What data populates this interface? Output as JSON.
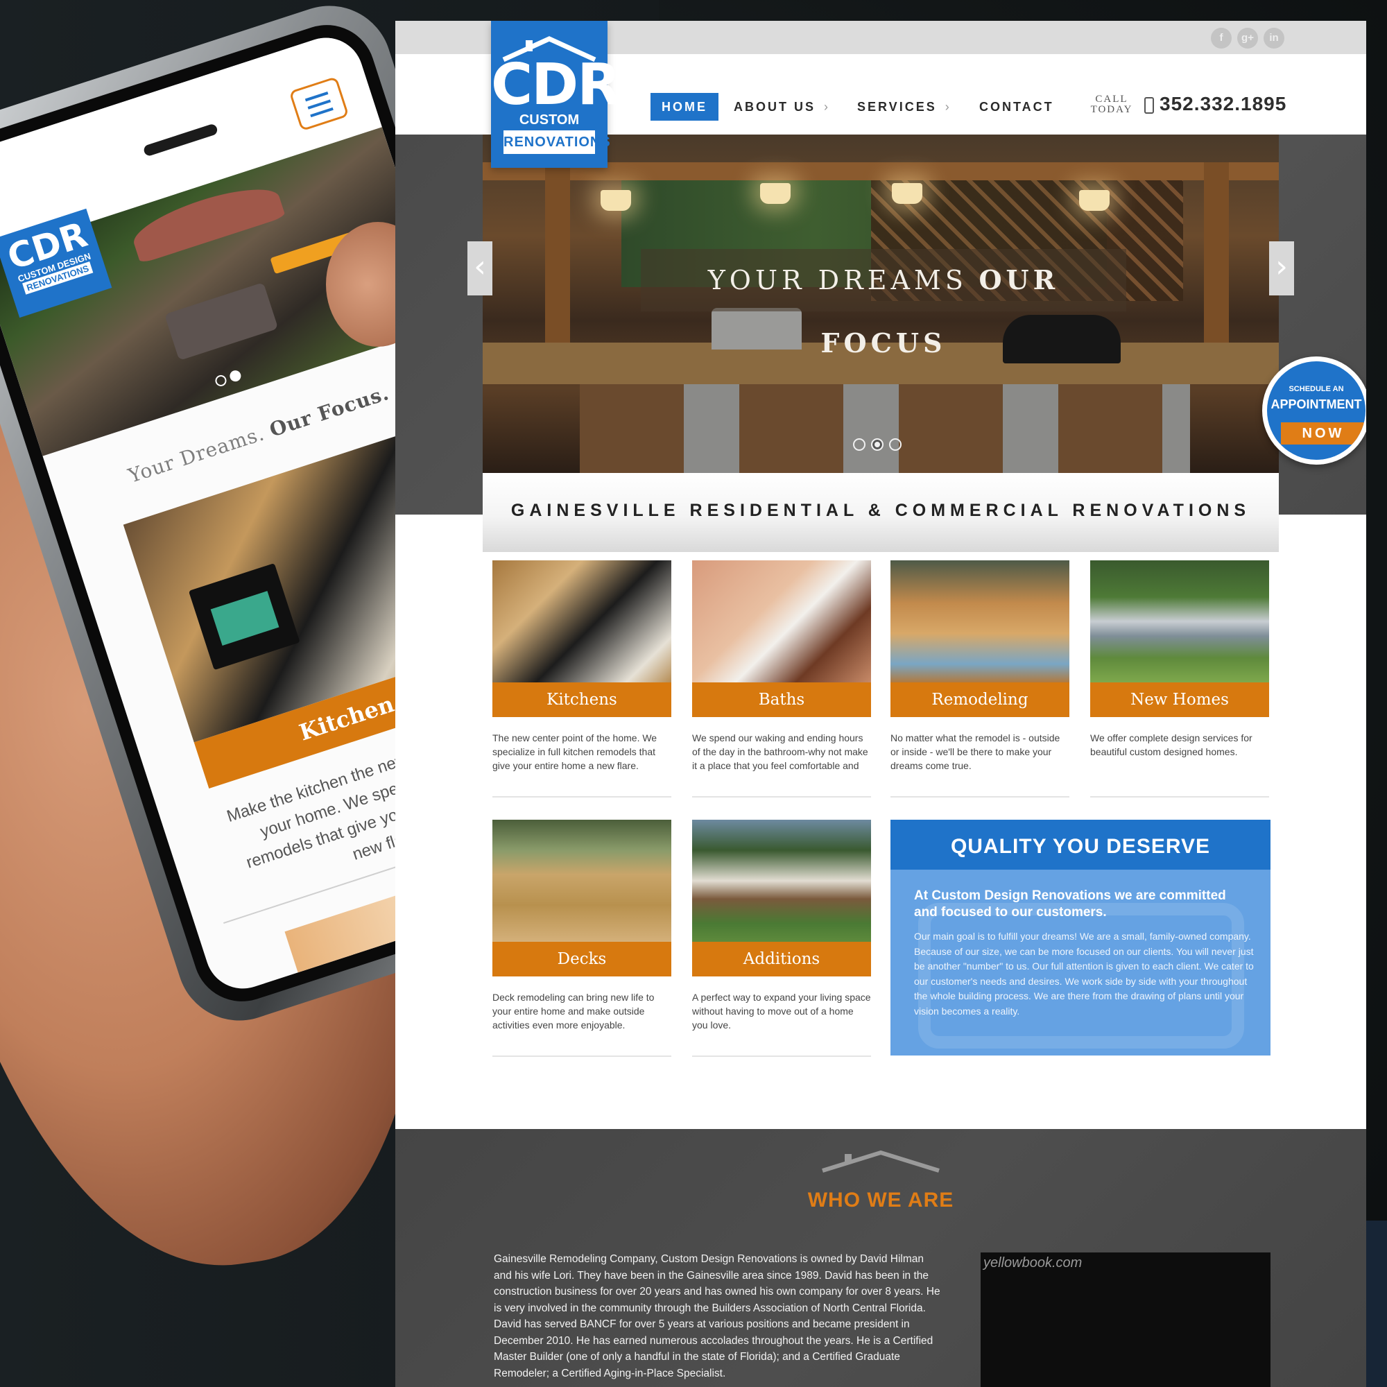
{
  "phone": {
    "logo_big": "CDR",
    "logo_small": "CUSTOM DESIGN",
    "logo_boxed": "RENOVATIONS",
    "tagline_light": "Your Dreams.",
    "tagline_bold": "Our Focus.",
    "card_label": "Kitchen",
    "card_text": "Make the kitchen the new focal point of your home. We specialize in full remodels that give your entire home a new flare."
  },
  "site": {
    "logo": {
      "big": "CDR",
      "line1": "CUSTOM DESIGN",
      "line2": "RENOVATIONS"
    },
    "social": [
      "f",
      "g+",
      "in"
    ],
    "nav": {
      "home": "HOME",
      "about": "ABOUT US",
      "services": "SERVICES",
      "contact": "CONTACT",
      "chevron": "›"
    },
    "call": {
      "line1": "CALL",
      "line2": "TODAY",
      "phone": "352.332.1895"
    },
    "hero": {
      "caption_light": "YOUR DREAMS",
      "caption_bold": "OUR FOCUS",
      "prev": "‹",
      "next": "›",
      "slide_count": 3,
      "active_slide": 2
    },
    "schedule": {
      "line1": "SCHEDULE AN",
      "line2": "APPOINTMENT",
      "line3": "NOW"
    },
    "tagline": "GAINESVILLE RESIDENTIAL & COMMERCIAL RENOVATIONS",
    "cards": [
      {
        "label": "Kitchens",
        "desc": "The new center point of the home. We specialize in full kitchen remodels that give your entire home a new flare."
      },
      {
        "label": "Baths",
        "desc": "We spend our waking and ending hours of the day in the bathroom-why not make it a place that you feel comfortable and"
      },
      {
        "label": "Remodeling",
        "desc": "No matter what the remodel is - outside or inside - we'll be there to make your dreams come true."
      },
      {
        "label": "New Homes",
        "desc": "We offer complete design services for beautiful custom designed homes."
      },
      {
        "label": "Decks",
        "desc": "Deck remodeling can bring new life to your entire home and make outside activities even more enjoyable."
      },
      {
        "label": "Additions",
        "desc": "A perfect way to expand your living space without having to move out of a home you love."
      }
    ],
    "quality": {
      "title": "QUALITY YOU DESERVE",
      "subtitle": "At Custom Design Renovations we are committed and focused to our customers.",
      "body": "Our main goal is to fulfill your dreams! We are a small, family-owned company. Because of our size, we can be more focused on our clients. You will never just be another \"number\" to us. Our full attention is given to each client. We cater to our customer's needs and desires. We work side by side with your throughout the whole building process. We are there from the drawing of plans until your vision becomes a reality."
    },
    "who": {
      "title": "WHO WE ARE",
      "body": "Gainesville Remodeling Company, Custom Design Renovations is owned by David Hilman and his wife Lori. They have been in the Gainesville area since 1989. David has been in the construction business for over 20 years and has owned his own company for over 8 years. He is very involved in the community through the Builders Association of North Central Florida. David has served BANCF for over 5 years at various positions and became president in December 2010. He has earned numerous accolades throughout the years. He is a Certified Master Builder (one of only a handful in the state of Florida); and a Certified Graduate Remodeler; a Certified Aging-in-Place Specialist.",
      "video_watermark": "yellowbook.com"
    }
  },
  "colors": {
    "brand_blue": "#1f73c9",
    "accent_orange": "#d7790f",
    "quality_blue": "#65a2e3",
    "dark_band": "#4a4a4a"
  },
  "icons": [
    "facebook-icon",
    "google-plus-icon",
    "linkedin-icon",
    "phone-icon",
    "chevron-right-icon",
    "chevron-left-icon",
    "hamburger-menu-icon",
    "roof-icon"
  ]
}
